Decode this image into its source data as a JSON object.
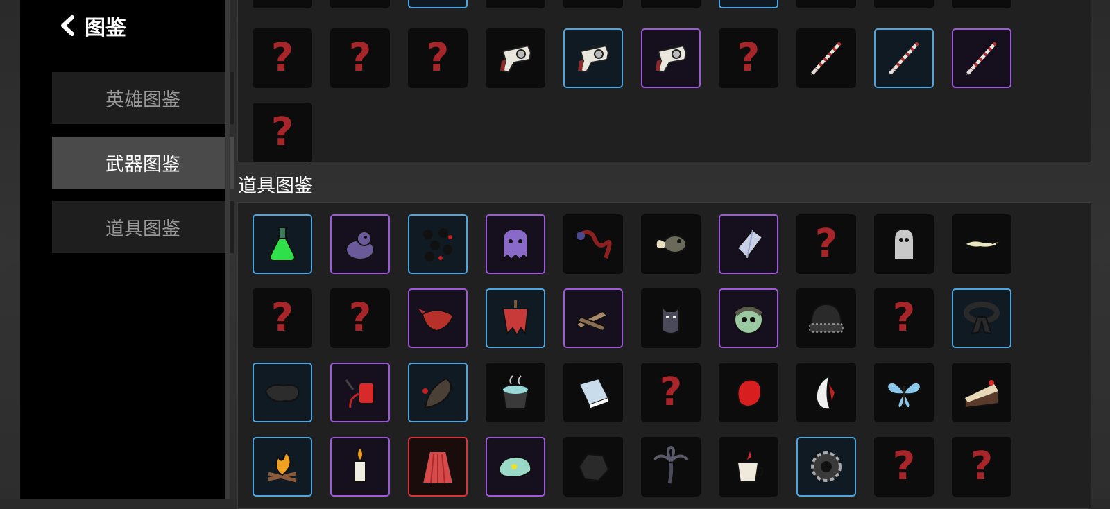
{
  "header": {
    "title": "图鉴"
  },
  "tabs": [
    {
      "label": "英雄图鉴",
      "active": false
    },
    {
      "label": "武器图鉴",
      "active": true
    },
    {
      "label": "道具图鉴",
      "active": false
    }
  ],
  "sections": {
    "items_title": "道具图鉴"
  },
  "weapons_partial_row": [
    {
      "rarity": "none",
      "icon": "question-mark"
    },
    {
      "rarity": "none",
      "icon": "unknown"
    },
    {
      "rarity": "blue",
      "icon": "unknown"
    },
    {
      "rarity": "none",
      "icon": "question-mark"
    },
    {
      "rarity": "none",
      "icon": "question-mark"
    },
    {
      "rarity": "none",
      "icon": "unknown"
    },
    {
      "rarity": "blue",
      "icon": "unknown"
    },
    {
      "rarity": "none",
      "icon": "question-mark"
    },
    {
      "rarity": "none",
      "icon": "question-mark"
    },
    {
      "rarity": "none",
      "icon": "question-mark"
    }
  ],
  "weapons_row": [
    {
      "rarity": "none",
      "icon": "question-mark"
    },
    {
      "rarity": "none",
      "icon": "question-mark"
    },
    {
      "rarity": "none",
      "icon": "question-mark"
    },
    {
      "rarity": "none",
      "icon": "revolver-icon"
    },
    {
      "rarity": "blue",
      "icon": "revolver-icon"
    },
    {
      "rarity": "purple",
      "icon": "revolver-icon"
    },
    {
      "rarity": "none",
      "icon": "question-mark"
    },
    {
      "rarity": "none",
      "icon": "spear-icon"
    },
    {
      "rarity": "blue",
      "icon": "spear-icon"
    },
    {
      "rarity": "purple",
      "icon": "spear-icon"
    }
  ],
  "weapons_last": [
    {
      "rarity": "none",
      "icon": "question-mark"
    }
  ],
  "items": [
    [
      {
        "rarity": "blue",
        "icon": "potion-flask-icon"
      },
      {
        "rarity": "purple",
        "icon": "blob-creature-icon"
      },
      {
        "rarity": "blue",
        "icon": "black-pellets-icon"
      },
      {
        "rarity": "purple",
        "icon": "ghost-icon"
      },
      {
        "rarity": "none",
        "icon": "serpent-icon"
      },
      {
        "rarity": "none",
        "icon": "eel-icon"
      },
      {
        "rarity": "purple",
        "icon": "crystal-shard-icon"
      },
      {
        "rarity": "none",
        "icon": "question-mark"
      },
      {
        "rarity": "none",
        "icon": "hooded-creature-icon"
      },
      {
        "rarity": "none",
        "icon": "lizard-icon"
      }
    ],
    [
      {
        "rarity": "none",
        "icon": "question-mark"
      },
      {
        "rarity": "none",
        "icon": "question-mark"
      },
      {
        "rarity": "purple",
        "icon": "red-bandana-icon"
      },
      {
        "rarity": "blue",
        "icon": "torn-banner-icon"
      },
      {
        "rarity": "purple",
        "icon": "wooden-planks-icon"
      },
      {
        "rarity": "none",
        "icon": "bat-icon"
      },
      {
        "rarity": "purple",
        "icon": "zombie-head-icon"
      },
      {
        "rarity": "none",
        "icon": "beanie-hat-icon"
      },
      {
        "rarity": "none",
        "icon": "question-mark"
      },
      {
        "rarity": "blue",
        "icon": "black-belt-icon"
      }
    ],
    [
      {
        "rarity": "blue",
        "icon": "black-cloth-icon"
      },
      {
        "rarity": "purple",
        "icon": "blood-bag-icon"
      },
      {
        "rarity": "blue",
        "icon": "leech-icon"
      },
      {
        "rarity": "none",
        "icon": "steaming-pot-icon"
      },
      {
        "rarity": "none",
        "icon": "book-icon"
      },
      {
        "rarity": "none",
        "icon": "question-mark"
      },
      {
        "rarity": "none",
        "icon": "red-glove-icon"
      },
      {
        "rarity": "none",
        "icon": "fang-icon"
      },
      {
        "rarity": "none",
        "icon": "butterfly-icon"
      },
      {
        "rarity": "none",
        "icon": "cake-slice-icon"
      }
    ],
    [
      {
        "rarity": "blue",
        "icon": "campfire-icon"
      },
      {
        "rarity": "purple",
        "icon": "candle-icon"
      },
      {
        "rarity": "red",
        "icon": "red-cape-icon"
      },
      {
        "rarity": "purple",
        "icon": "chameleon-icon"
      },
      {
        "rarity": "none",
        "icon": "black-rock-icon"
      },
      {
        "rarity": "none",
        "icon": "palm-tree-icon"
      },
      {
        "rarity": "none",
        "icon": "coffee-cup-icon"
      },
      {
        "rarity": "blue",
        "icon": "gear-icon"
      },
      {
        "rarity": "none",
        "icon": "question-mark"
      },
      {
        "rarity": "none",
        "icon": "question-mark"
      }
    ]
  ],
  "colors": {
    "blue_border": "#4ea6e0",
    "purple_border": "#9c5ad8",
    "red_border": "#d8343a",
    "question_red": "#a8262a"
  },
  "unknown_symbol": "?"
}
